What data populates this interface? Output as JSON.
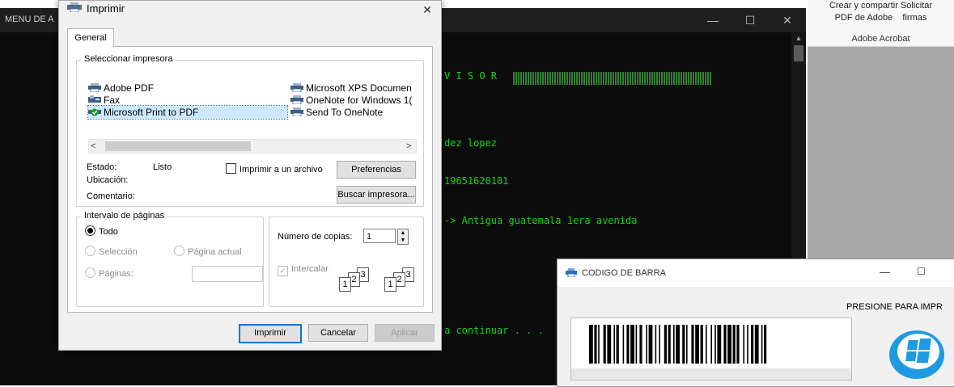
{
  "console": {
    "title": "MENU DE A",
    "lines": [
      "V I S O R",
      "dez lopez",
      "19651620101",
      "-> Antigua guatemala 1era avenida",
      "a continuar . . ."
    ]
  },
  "acrobat": {
    "tool_line1": "Crear y compartir Solicitar",
    "tool_line2": "PDF de Adobe    firmas",
    "group_label": "Adobe Acrobat"
  },
  "print_dialog": {
    "title": "Imprimir",
    "tab_general": "General",
    "select_printer_legend": "Seleccionar impresora",
    "printers": [
      "Adobe PDF",
      "Fax",
      "Microsoft Print to PDF",
      "Microsoft XPS Documen",
      "OneNote for Windows 1(",
      "Send To OneNote"
    ],
    "selected_printer_index": 2,
    "status_label": "Estado:",
    "status_value": "Listo",
    "location_label": "Ubicación:",
    "comment_label": "Comentario:",
    "print_to_file_label": "Imprimir a un archivo",
    "preferences_button": "Preferencias",
    "find_printer_button": "Buscar impresora...",
    "page_range_legend": "Intervalo de páginas",
    "range_all": "Todo",
    "range_selection": "Selección",
    "range_current": "Página actual",
    "range_pages": "Páginas:",
    "copies_label": "Número de copias:",
    "copies_value": "1",
    "collate_label": "Intercalar",
    "print_button": "Imprimir",
    "cancel_button": "Cancelar",
    "apply_button": "Aplicar"
  },
  "barcode_window": {
    "title": "CODIGO DE BARRA",
    "hint": "PRESIONE PARA IMPR"
  },
  "colors": {
    "console_text": "#17d21a",
    "selection": "#cce8ff",
    "primary_border": "#0078d7",
    "win_logo": "#1e9be0"
  }
}
